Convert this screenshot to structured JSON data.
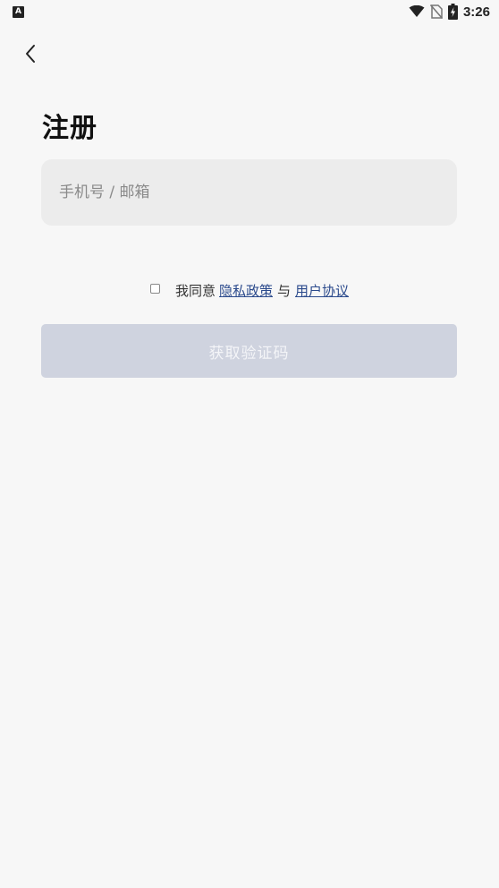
{
  "status_bar": {
    "app_icon_letter": "A",
    "time": "3:26",
    "icons": [
      "wifi-icon",
      "no-sim-icon",
      "battery-charging-icon"
    ]
  },
  "header": {
    "back_icon": "chevron-left-icon"
  },
  "title": "注册",
  "account_input": {
    "placeholder": "手机号 / 邮箱",
    "value": ""
  },
  "agreement": {
    "checked": false,
    "prefix": "我同意",
    "privacy_link": "隐私政策",
    "connector": "与",
    "terms_link": "用户协议"
  },
  "submit_button": {
    "label": "获取验证码",
    "enabled": false
  },
  "colors": {
    "background": "#f7f7f7",
    "input_bg": "#ececec",
    "link": "#2b4a8c",
    "button_disabled_bg": "#cfd3df"
  }
}
